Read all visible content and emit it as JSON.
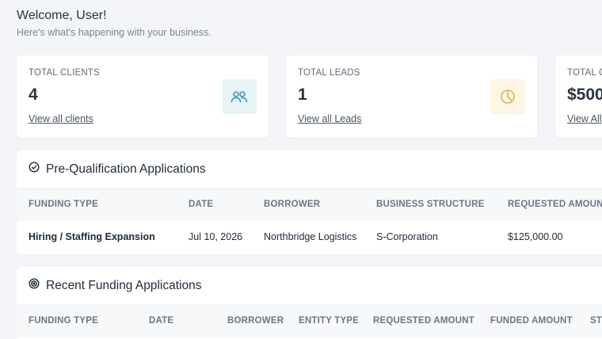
{
  "welcome": {
    "title": "Welcome, User!",
    "subtitle": "Here's what's happening with your business."
  },
  "stats": [
    {
      "label": "TOTAL CLIENTS",
      "value": "4",
      "link": "View all clients",
      "icon": "users-icon",
      "icon_color": "#3a9bb0"
    },
    {
      "label": "TOTAL LEADS",
      "value": "1",
      "link": "View all Leads",
      "icon": "pie-chart-icon",
      "icon_color": "#e2b04a"
    },
    {
      "label": "TOTAL C",
      "value": "$500",
      "link": "View All"
    }
  ],
  "prequal": {
    "title": "Pre-Qualification Applications",
    "icon": "check-circle-icon",
    "columns": [
      "FUNDING TYPE",
      "DATE",
      "BORROWER",
      "BUSINESS STRUCTURE",
      "REQUESTED AMOUNT"
    ],
    "rows": [
      [
        "Hiring / Staffing Expansion",
        "Jul 10, 2026",
        "Northbridge Logistics",
        "S-Corporation",
        "$125,000.00"
      ]
    ]
  },
  "funding": {
    "title": "Recent Funding Applications",
    "icon": "target-icon",
    "columns": [
      "FUNDING TYPE",
      "DATE",
      "BORROWER",
      "ENTITY TYPE",
      "REQUESTED AMOUNT",
      "FUNDED AMOUNT",
      "ST"
    ]
  }
}
